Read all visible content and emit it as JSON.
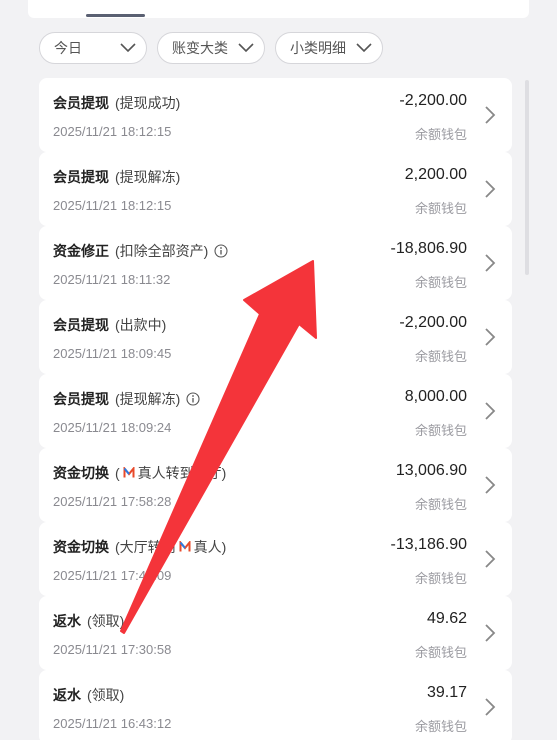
{
  "filters": [
    {
      "label": "今日"
    },
    {
      "label": "账变大类"
    },
    {
      "label": "小类明细"
    }
  ],
  "records": [
    {
      "title": "会员提现",
      "sub": "(提现成功)",
      "time": "2025/11/21 18:12:15",
      "amount": "-2,200.00",
      "wallet": "余额钱包",
      "info": false
    },
    {
      "title": "会员提现",
      "sub": "(提现解冻)",
      "time": "2025/11/21 18:12:15",
      "amount": "2,200.00",
      "wallet": "余额钱包",
      "info": false
    },
    {
      "title": "资金修正",
      "sub": "(扣除全部资产)",
      "time": "2025/11/21 18:11:32",
      "amount": "-18,806.90",
      "wallet": "余额钱包",
      "info": true
    },
    {
      "title": "会员提现",
      "sub": "(出款中)",
      "time": "2025/11/21 18:09:45",
      "amount": "-2,200.00",
      "wallet": "余额钱包",
      "info": false
    },
    {
      "title": "会员提现",
      "sub": "(提现解冻)",
      "time": "2025/11/21 18:09:24",
      "amount": "8,000.00",
      "wallet": "余额钱包",
      "info": true
    },
    {
      "title": "资金切换",
      "sub_prefix": "(",
      "sub_a": "真人转到大厅",
      "sub_suffix": ")",
      "time": "2025/11/21 17:58:28",
      "amount": "13,006.90",
      "wallet": "余额钱包",
      "info": false
    },
    {
      "title": "资金切换",
      "sub_prefix": "(大厅转到",
      "sub_a": "真人",
      "sub_suffix": ")",
      "time": "2025/11/21 17:49:09",
      "amount": "-13,186.90",
      "wallet": "余额钱包",
      "info": false
    },
    {
      "title": "返水",
      "sub": "(领取)",
      "time": "2025/11/21 17:30:58",
      "amount": "49.62",
      "wallet": "余额钱包",
      "info": false
    },
    {
      "title": "返水",
      "sub": "(领取)",
      "time": "2025/11/21 16:43:12",
      "amount": "39.17",
      "wallet": "余额钱包",
      "info": false
    }
  ],
  "colors": {
    "background": "#f2f2f4",
    "card": "#ffffff",
    "arrow": "#f4343a",
    "tab_underline": "#5a6072"
  }
}
